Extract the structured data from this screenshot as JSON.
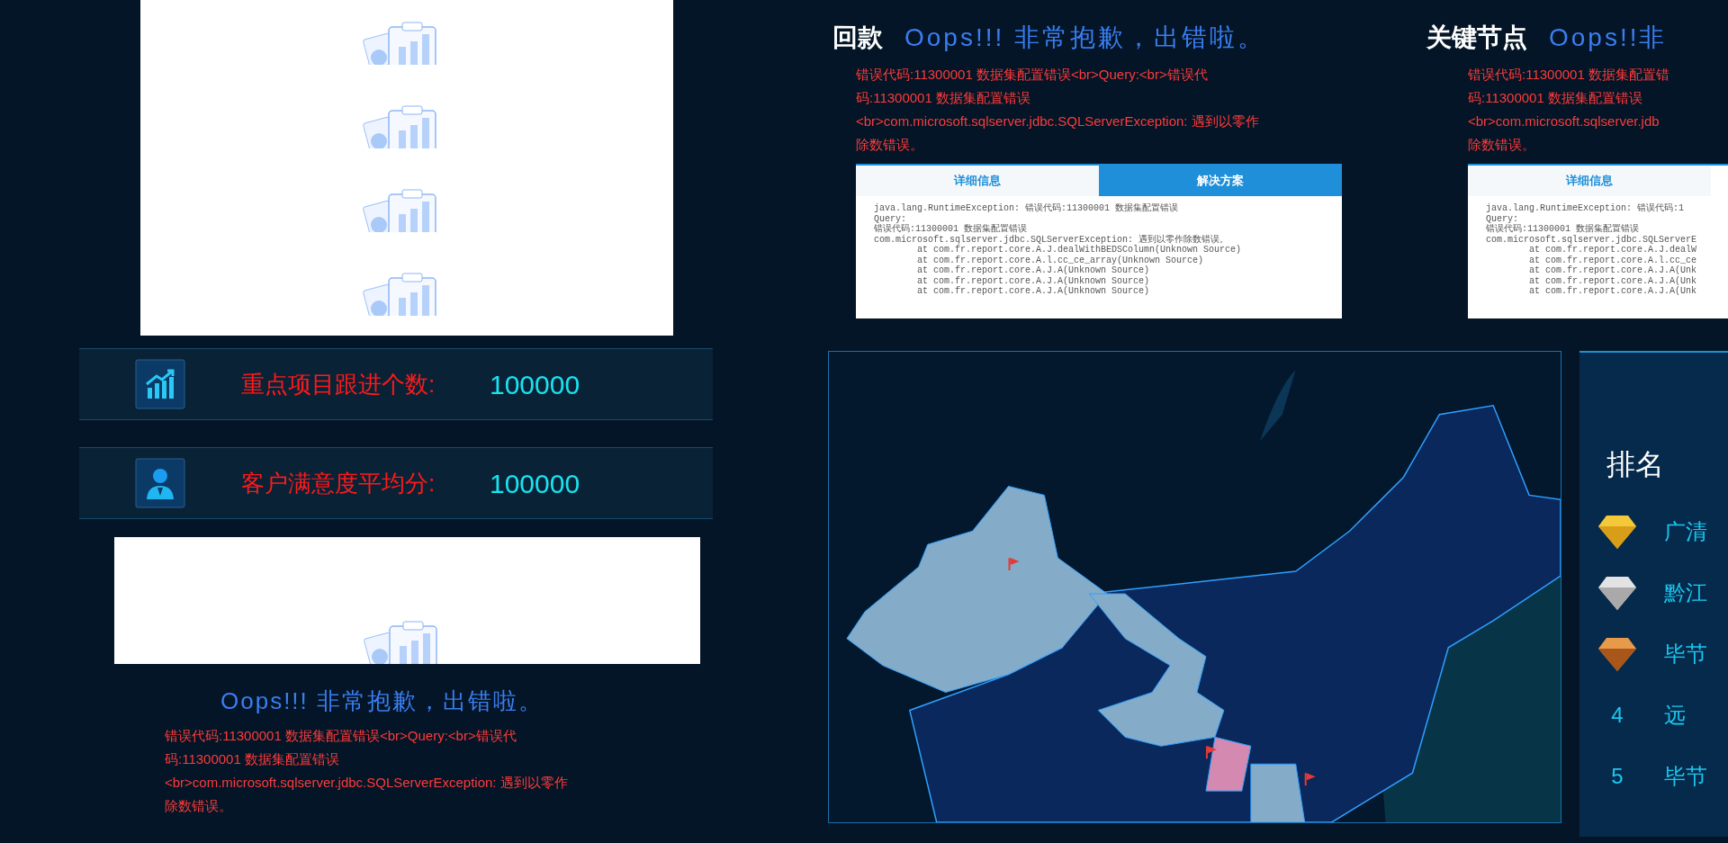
{
  "empty_charts": [
    {
      "kind": "no-data"
    },
    {
      "kind": "no-data"
    },
    {
      "kind": "no-data"
    },
    {
      "kind": "no-data"
    }
  ],
  "metrics": [
    {
      "kind": "growth",
      "label": "重点项目跟进个数:",
      "value": "100000"
    },
    {
      "kind": "person",
      "label": "客户满意度平均分:",
      "value": "100000"
    }
  ],
  "bottom_left": {
    "message": "Oops!!! 非常抱歉，出错啦。",
    "error_lines": [
      "错误代码:11300001 数据集配置错误<br>Query:<br>错误代",
      "码:11300001 数据集配置错误",
      "<br>com.microsoft.sqlserver.jdbc.SQLServerException: 遇到以零作",
      "除数错误。"
    ]
  },
  "panels": [
    {
      "title": "回款",
      "message": "Oops!!! 非常抱歉，出错啦。",
      "error_lines": [
        "错误代码:11300001 数据集配置错误<br>Query:<br>错误代",
        "码:11300001 数据集配置错误",
        "<br>com.microsoft.sqlserver.jdbc.SQLServerException: 遇到以零作",
        "除数错误。"
      ],
      "tabs": [
        {
          "label": "详细信息",
          "selected": false
        },
        {
          "label": "解决方案",
          "selected": true
        }
      ],
      "trace": [
        "java.lang.RuntimeException: 错误代码:11300001 数据集配置错误",
        "Query:",
        "错误代码:11300001 数据集配置错误",
        "com.microsoft.sqlserver.jdbc.SQLServerException: 遇到以零作除数错误。",
        "        at com.fr.report.core.A.J.dealWithBEDSColumn(Unknown Source)",
        "        at com.fr.report.core.A.l.cc_ce_array(Unknown Source)",
        "        at com.fr.report.core.A.J.A(Unknown Source)",
        "        at com.fr.report.core.A.J.A(Unknown Source)",
        "        at com.fr.report.core.A.J.A(Unknown Source)"
      ]
    },
    {
      "title": "关键节点",
      "message": "Oops!!非",
      "error_lines": [
        "错误代码:11300001 数据集配置错",
        "码:11300001 数据集配置错误",
        "<br>com.microsoft.sqlserver.jdb",
        "除数错误。"
      ],
      "tabs": [
        {
          "label": "详细信息",
          "selected": false
        }
      ],
      "trace": [
        "java.lang.RuntimeException: 错误代码:1",
        "Query:",
        "错误代码:11300001 数据集配置错误",
        "com.microsoft.sqlserver.jdbc.SQLServerE",
        "        at com.fr.report.core.A.J.dealW",
        "        at com.fr.report.core.A.l.cc_ce",
        "        at com.fr.report.core.A.J.A(Unk",
        "        at com.fr.report.core.A.J.A(Unk",
        "        at com.fr.report.core.A.J.A(Unk"
      ]
    }
  ],
  "ranking": {
    "title": "排名",
    "items": [
      {
        "kind": "gold",
        "name": "广清"
      },
      {
        "kind": "silver",
        "name": "黔江"
      },
      {
        "kind": "bronze",
        "name": "毕节"
      },
      {
        "kind": "number",
        "rank": "4",
        "name": "远"
      },
      {
        "kind": "number",
        "rank": "5",
        "name": "毕节"
      }
    ]
  }
}
